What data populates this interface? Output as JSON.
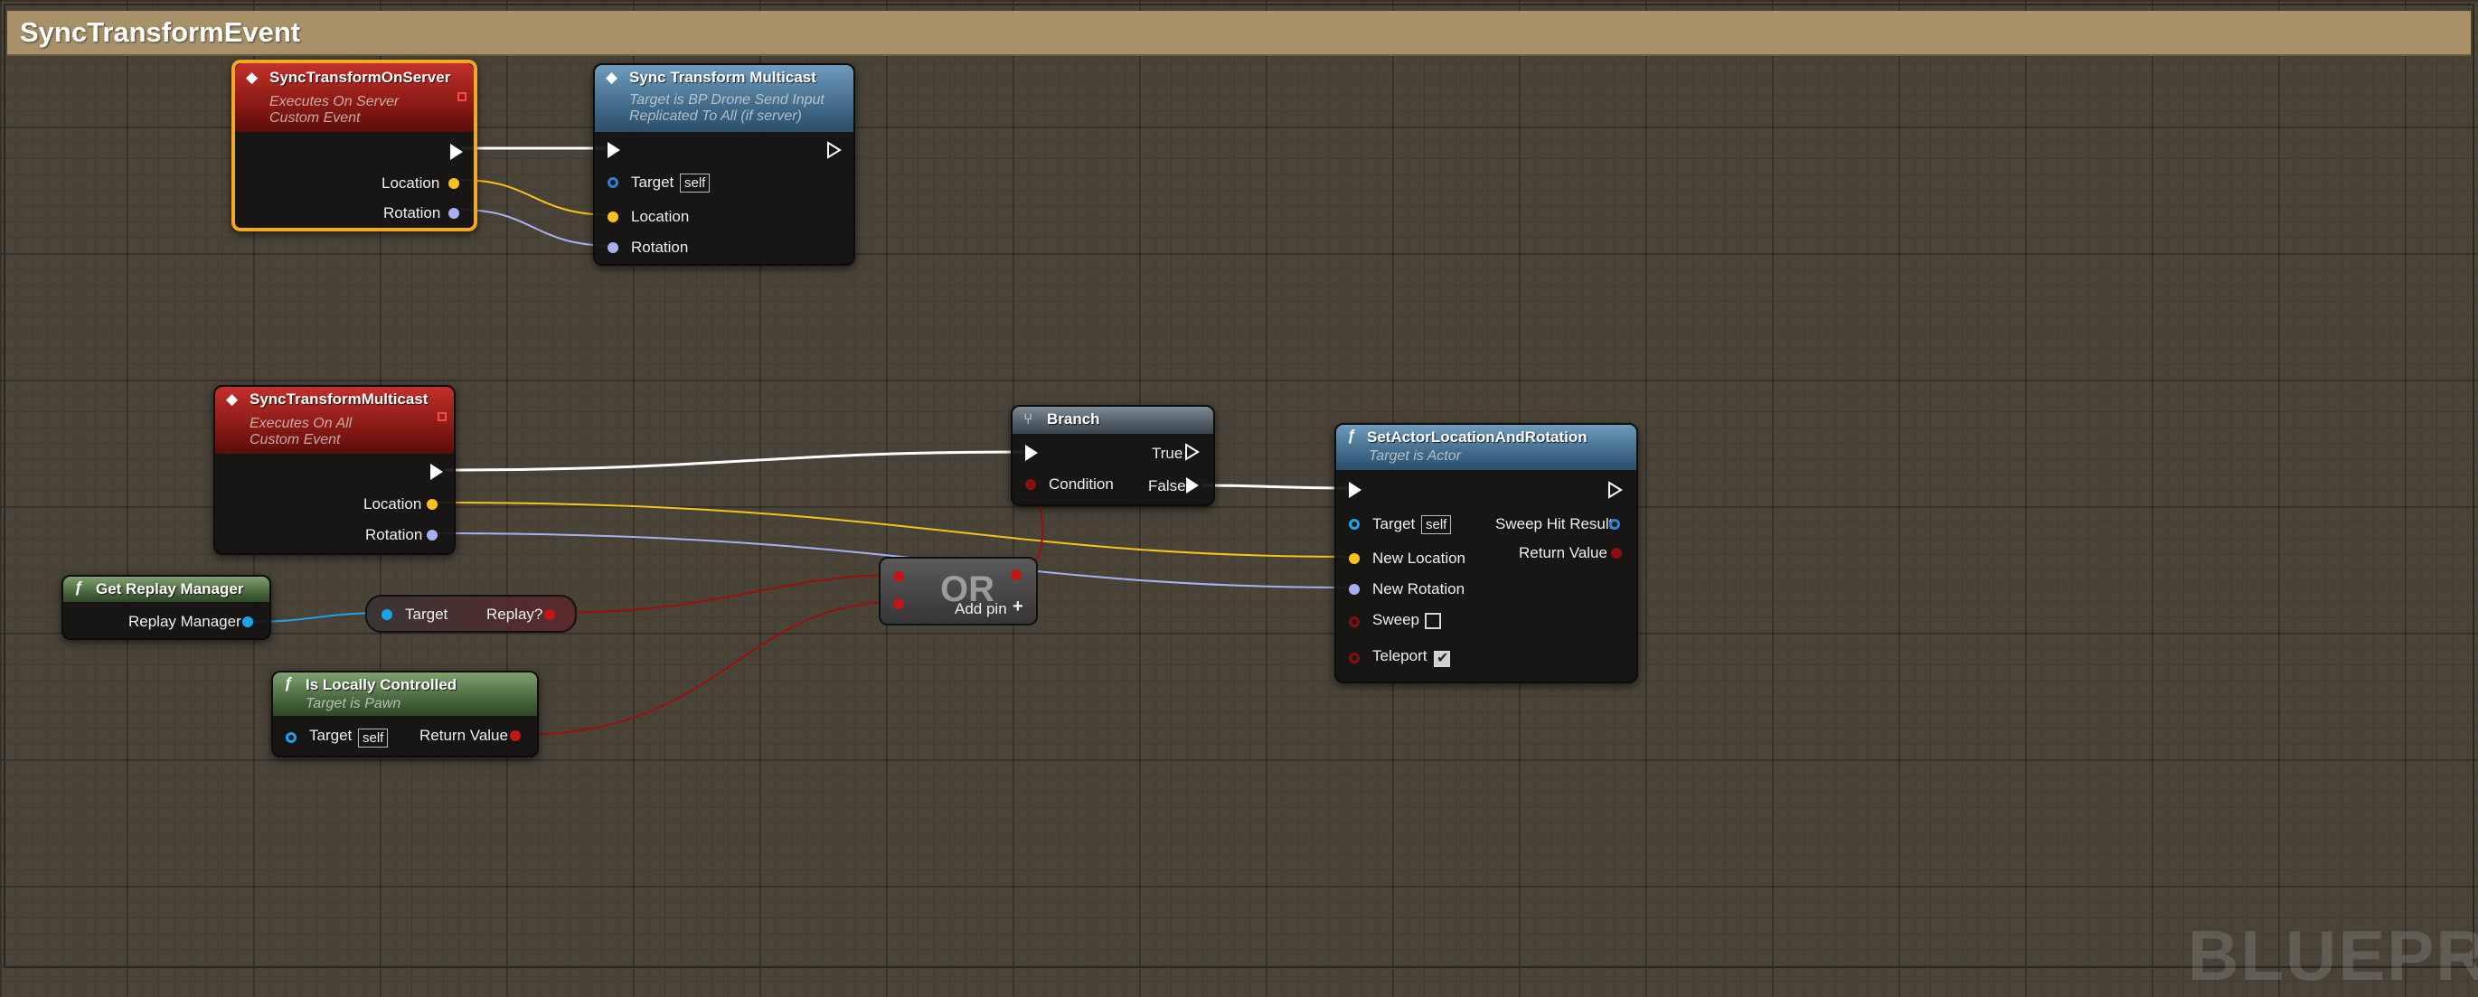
{
  "comment": {
    "title": "SyncTransformEvent"
  },
  "watermark": "BLUEPRI",
  "nodes": {
    "sync_on_server": {
      "title": "SyncTransformOnServer",
      "subtitle1": "Executes On Server",
      "subtitle2": "Custom Event",
      "pins": {
        "location": "Location",
        "rotation": "Rotation"
      }
    },
    "sync_multicast_call": {
      "title": "Sync Transform Multicast",
      "subtitle1": "Target is BP Drone Send Input",
      "subtitle2": "Replicated To All (if server)",
      "pins": {
        "target": "Target",
        "target_default": "self",
        "location": "Location",
        "rotation": "Rotation"
      }
    },
    "sync_multicast_event": {
      "title": "SyncTransformMulticast",
      "subtitle1": "Executes On All",
      "subtitle2": "Custom Event",
      "pins": {
        "location": "Location",
        "rotation": "Rotation"
      }
    },
    "branch": {
      "title": "Branch",
      "pins": {
        "condition": "Condition",
        "true": "True",
        "false": "False"
      }
    },
    "set_actor": {
      "title": "SetActorLocationAndRotation",
      "subtitle1": "Target is Actor",
      "pins": {
        "target": "Target",
        "target_default": "self",
        "new_location": "New Location",
        "new_rotation": "New Rotation",
        "sweep": "Sweep",
        "teleport": "Teleport",
        "sweep_hit_result": "Sweep Hit Result",
        "return_value": "Return Value"
      },
      "sweep_checked": false,
      "teleport_checked": true
    },
    "get_replay_manager": {
      "title": "Get Replay Manager",
      "pins": {
        "replay_manager": "Replay Manager"
      }
    },
    "replay_var": {
      "pins": {
        "target": "Target",
        "replay": "Replay?"
      }
    },
    "or_node": {
      "title": "OR",
      "add_pin": "Add pin"
    },
    "is_locally_controlled": {
      "title": "Is Locally Controlled",
      "subtitle1": "Target is Pawn",
      "pins": {
        "target": "Target",
        "target_default": "self",
        "return_value": "Return Value"
      }
    }
  },
  "colors": {
    "exec_wire": "#ffffff",
    "location_wire": "#f7c21a",
    "rotation_wire": "#a7b0f2",
    "object_wire": "#19a6e8",
    "bool_wire": "#9a0f0f",
    "selection": "#f5a623"
  },
  "icons": {
    "event": "event-diamond-icon",
    "function": "function-f-icon",
    "branch": "branch-icon",
    "add": "plus-icon"
  }
}
